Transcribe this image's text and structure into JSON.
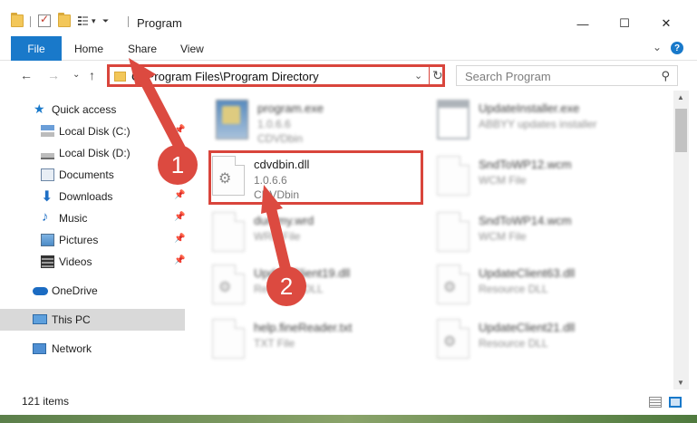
{
  "window": {
    "title": "Program",
    "minimize": "—",
    "maximize": "☐",
    "close": "✕"
  },
  "ribbon": {
    "file": "File",
    "home": "Home",
    "share": "Share",
    "view": "View",
    "expand": "⌄",
    "help": "?"
  },
  "navigation": {
    "back": "←",
    "forward": "→",
    "recent": "⌄",
    "up": "↑",
    "address": "C:\\Program Files\\Program Directory",
    "dropdown": "⌄",
    "refresh": "↻",
    "search_placeholder": "Search Program",
    "search_icon": "⚲"
  },
  "sidebar": {
    "items": [
      {
        "label": "Quick access",
        "icon": "star-icon",
        "pinned": false
      },
      {
        "label": "Local Disk (C:)",
        "icon": "drive-icon",
        "pinned": true
      },
      {
        "label": "Local Disk (D:)",
        "icon": "drive-icon",
        "pinned": false
      },
      {
        "label": "Documents",
        "icon": "documents-icon",
        "pinned": true
      },
      {
        "label": "Downloads",
        "icon": "download-icon",
        "pinned": true
      },
      {
        "label": "Music",
        "icon": "music-icon",
        "pinned": true
      },
      {
        "label": "Pictures",
        "icon": "pictures-icon",
        "pinned": true
      },
      {
        "label": "Videos",
        "icon": "videos-icon",
        "pinned": true
      },
      {
        "label": "OneDrive",
        "icon": "cloud-icon",
        "pinned": false
      },
      {
        "label": "This PC",
        "icon": "computer-icon",
        "pinned": false,
        "selected": true
      },
      {
        "label": "Network",
        "icon": "network-icon",
        "pinned": false
      }
    ],
    "pin_glyph": "📌"
  },
  "files": {
    "left": [
      {
        "name": "program.exe",
        "line1": "1.0.6.6",
        "line2": "CDVDbin",
        "thumb": "exe"
      },
      {
        "name": "cdvdbin.dll",
        "line1": "1.0.6.6",
        "line2": "CDVDbin",
        "thumb": "dll"
      },
      {
        "name": "dummy.wrd",
        "line1": "WRD File",
        "line2": "",
        "thumb": "doc"
      },
      {
        "name": "UpdateClient19.dll",
        "line1": "Resource DLL",
        "line2": "",
        "thumb": "dll"
      },
      {
        "name": "help.fineReader.txt",
        "line1": "TXT File",
        "line2": "",
        "thumb": "doc"
      }
    ],
    "right": [
      {
        "name": "UpdateInstaller.exe",
        "line1": "ABBYY updates installer",
        "line2": "",
        "thumb": "win"
      },
      {
        "name": "SndToWP12.wcm",
        "line1": "WCM File",
        "line2": "",
        "thumb": "doc"
      },
      {
        "name": "SndToWP14.wcm",
        "line1": "WCM File",
        "line2": "",
        "thumb": "doc"
      },
      {
        "name": "UpdateClient63.dll",
        "line1": "Resource DLL",
        "line2": "",
        "thumb": "dll"
      },
      {
        "name": "UpdateClient21.dll",
        "line1": "Resource DLL",
        "line2": "",
        "thumb": "dll"
      }
    ],
    "gear_glyph": "⚙"
  },
  "status": {
    "item_count": "121 items"
  },
  "annotations": {
    "step1": "1",
    "step2": "2",
    "color": "#dc4a40"
  },
  "scroll": {
    "up": "▲",
    "down": "▼"
  }
}
